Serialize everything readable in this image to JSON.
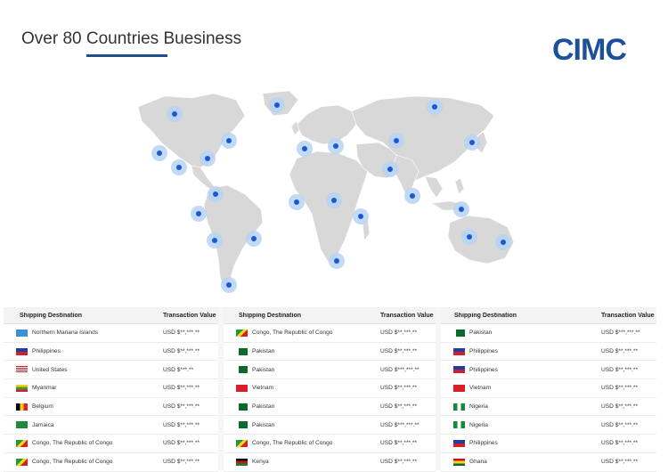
{
  "header": {
    "title": "Over 80 Countries Buesiness",
    "logo": "CIMC"
  },
  "colors": {
    "accent": "#1f4e8c",
    "logo": "#1c4f9c",
    "marker": "#1a58d6",
    "land": "#d8d8d8"
  },
  "tables": [
    {
      "col_destination": "Shipping Destination",
      "col_value": "Transaction Value",
      "rows": [
        {
          "flag": "northern-mariana-flag-icon",
          "destination": "Northern Mariana Islands",
          "value": "USD $**,***.**"
        },
        {
          "flag": "philippines-flag-icon",
          "destination": "Philippines",
          "value": "USD $**,***.**"
        },
        {
          "flag": "usa-flag-icon",
          "destination": "United States",
          "value": "USD $***.**"
        },
        {
          "flag": "myanmar-flag-icon",
          "destination": "Myanmar",
          "value": "USD $**,***.**"
        },
        {
          "flag": "belgium-flag-icon",
          "destination": "Belgium",
          "value": "USD $**,***.**"
        },
        {
          "flag": "jamaica-flag-icon",
          "destination": "Jamaica",
          "value": "USD $**,***.**"
        },
        {
          "flag": "congo-flag-icon",
          "destination": "Congo, The Republic of Congo",
          "value": "USD $**,***.**"
        },
        {
          "flag": "congo-flag-icon",
          "destination": "Congo, The Republic of Congo",
          "value": "USD $**,***.**"
        }
      ]
    },
    {
      "col_destination": "Shipping Destination",
      "col_value": "Transaction Value",
      "rows": [
        {
          "flag": "congo-flag-icon",
          "destination": "Congo, The Republic of Congo",
          "value": "USD $**,***.**"
        },
        {
          "flag": "pakistan-flag-icon",
          "destination": "Pakistan",
          "value": "USD $**,***.**"
        },
        {
          "flag": "pakistan-flag-icon",
          "destination": "Pakistan",
          "value": "USD $***,***.**"
        },
        {
          "flag": "vietnam-flag-icon",
          "destination": "Vietnam",
          "value": "USD $**,***.**"
        },
        {
          "flag": "pakistan-flag-icon",
          "destination": "Pakistan",
          "value": "USD $**,***.**"
        },
        {
          "flag": "pakistan-flag-icon",
          "destination": "Pakistan",
          "value": "USD $***,***.**"
        },
        {
          "flag": "congo-flag-icon",
          "destination": "Congo, The Republic of Congo",
          "value": "USD $**,***.**"
        },
        {
          "flag": "kenya-flag-icon",
          "destination": "Kenya",
          "value": "USD $**,***.**"
        }
      ]
    },
    {
      "col_destination": "Shipping Destination",
      "col_value": "Transaction Value",
      "rows": [
        {
          "flag": "pakistan-flag-icon",
          "destination": "Pakistan",
          "value": "USD $***,***.**"
        },
        {
          "flag": "philippines-flag-icon",
          "destination": "Philippines",
          "value": "USD $**,***.**"
        },
        {
          "flag": "philippines-flag-icon",
          "destination": "Philippines",
          "value": "USD $**,***.**"
        },
        {
          "flag": "vietnam-flag-icon",
          "destination": "Vietnam",
          "value": "USD $**,***.**"
        },
        {
          "flag": "nigeria-flag-icon",
          "destination": "Nigeria",
          "value": "USD $**,***.**"
        },
        {
          "flag": "nigeria-flag-icon",
          "destination": "Nigeria",
          "value": "USD $**,***.**"
        },
        {
          "flag": "philippines-flag-icon",
          "destination": "Philippines",
          "value": "USD $**,***.**"
        },
        {
          "flag": "ghana-flag-icon",
          "destination": "Ghana",
          "value": "USD $**,***.**"
        }
      ]
    }
  ]
}
